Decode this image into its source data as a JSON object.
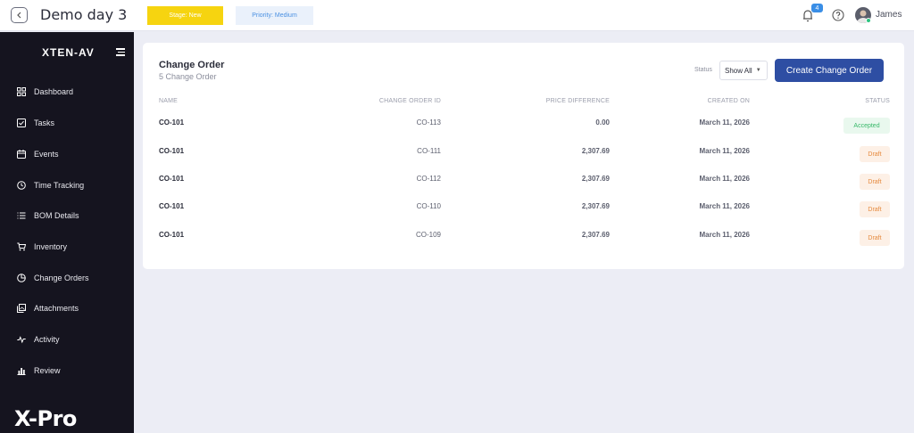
{
  "header": {
    "title": "Demo day 3",
    "stage_label": "Stage: New",
    "priority_label": "Priority: Medium",
    "notification_count": "4",
    "user_name": "James",
    "stage_color": "#f6d410",
    "priority_color": "#4a90e2"
  },
  "sidebar": {
    "brand": "XTEN-AV",
    "footer_logo": "X-Pro",
    "items": [
      {
        "label": "Dashboard",
        "icon": "grid-icon"
      },
      {
        "label": "Tasks",
        "icon": "checkbox-icon"
      },
      {
        "label": "Events",
        "icon": "calendar-icon"
      },
      {
        "label": "Time Tracking",
        "icon": "clock-icon"
      },
      {
        "label": "BOM Details",
        "icon": "list-icon"
      },
      {
        "label": "Inventory",
        "icon": "cart-icon"
      },
      {
        "label": "Change Orders",
        "icon": "pie-icon"
      },
      {
        "label": "Attachments",
        "icon": "gallery-icon"
      },
      {
        "label": "Activity",
        "icon": "pulse-icon"
      },
      {
        "label": "Review",
        "icon": "bar-chart-icon"
      }
    ]
  },
  "change_order": {
    "title": "Change Order",
    "subtitle": "5 Change Order",
    "status_filter_label": "Status",
    "status_filter_value": "Show All",
    "create_button": "Create Change Order",
    "columns": [
      "NAME",
      "CHANGE ORDER ID",
      "PRICE DIFFERENCE",
      "CREATED ON",
      "STATUS"
    ],
    "rows": [
      {
        "name": "CO-101",
        "id": "CO-113",
        "price": "0.00",
        "created": "March 11, 2026",
        "status": "Accepted"
      },
      {
        "name": "CO-101",
        "id": "CO-111",
        "price": "2,307.69",
        "created": "March 11, 2026",
        "status": "Draft"
      },
      {
        "name": "CO-101",
        "id": "CO-112",
        "price": "2,307.69",
        "created": "March 11, 2026",
        "status": "Draft"
      },
      {
        "name": "CO-101",
        "id": "CO-110",
        "price": "2,307.69",
        "created": "March 11, 2026",
        "status": "Draft"
      },
      {
        "name": "CO-101",
        "id": "CO-109",
        "price": "2,307.69",
        "created": "March 11, 2026",
        "status": "Draft"
      }
    ],
    "accent_color": "#2e4ea3"
  }
}
